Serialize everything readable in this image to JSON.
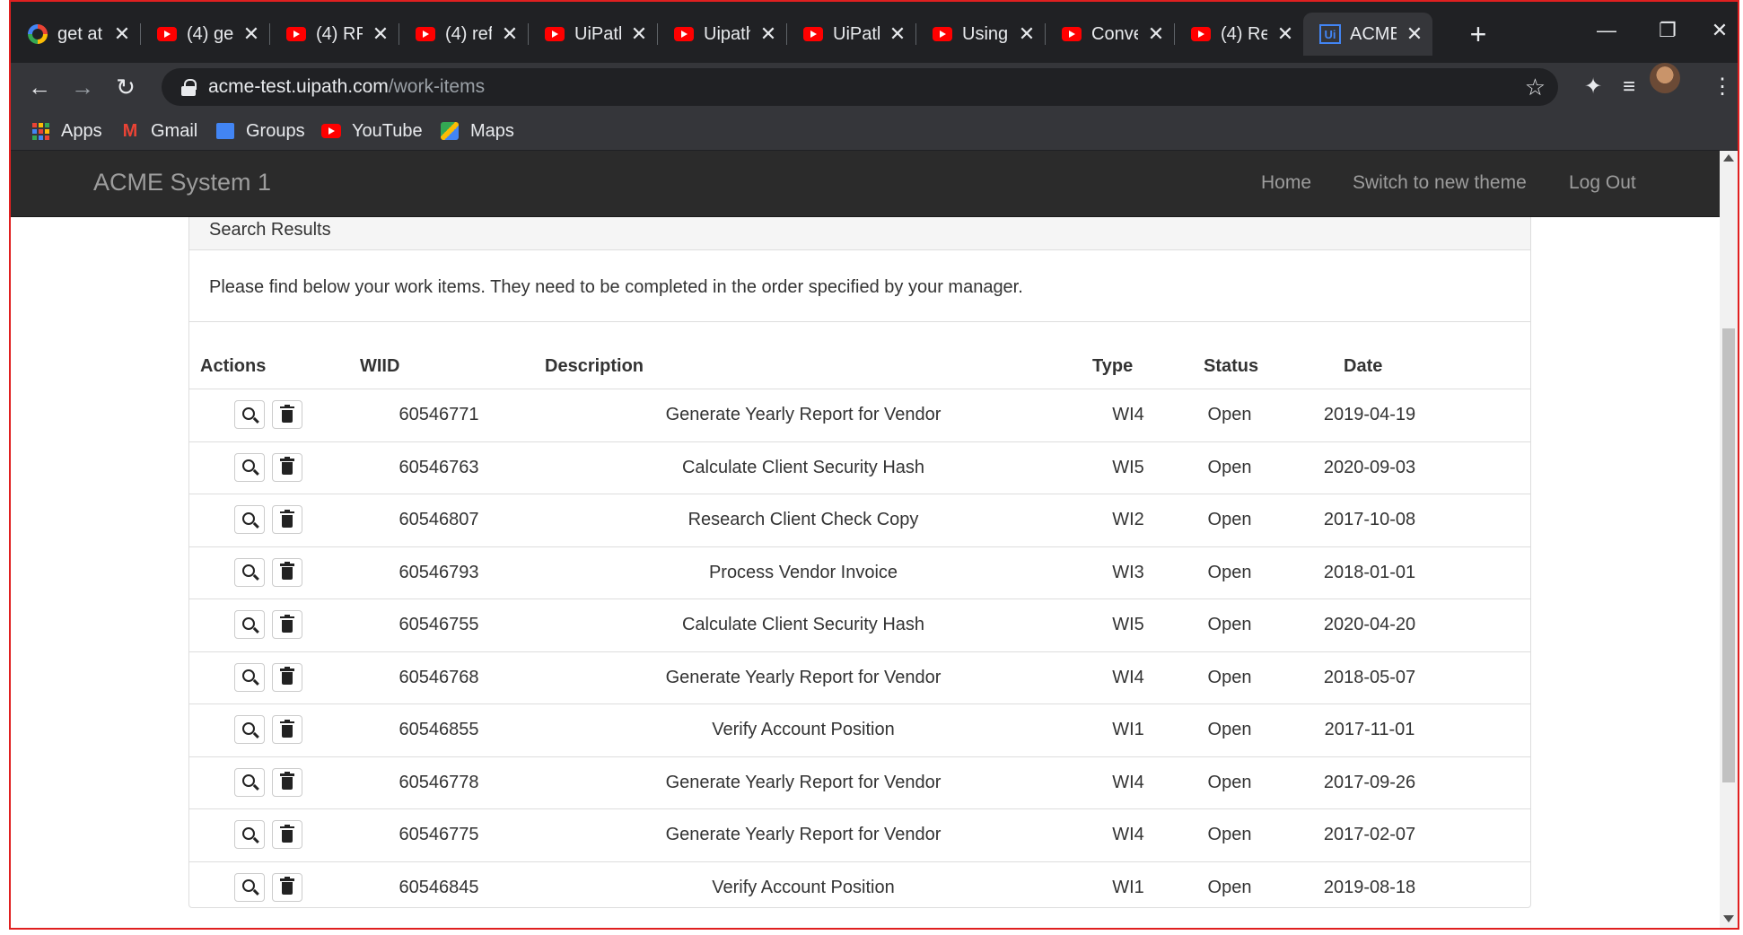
{
  "browser": {
    "tabs": [
      {
        "title": "get at",
        "icon": "google-icon"
      },
      {
        "title": "(4) ge",
        "icon": "youtube-icon"
      },
      {
        "title": "(4) RP",
        "icon": "youtube-icon"
      },
      {
        "title": "(4) ref",
        "icon": "youtube-icon"
      },
      {
        "title": "UiPath",
        "icon": "youtube-icon"
      },
      {
        "title": "Uipath",
        "icon": "youtube-icon"
      },
      {
        "title": "UiPath",
        "icon": "youtube-icon"
      },
      {
        "title": "Using",
        "icon": "youtube-icon"
      },
      {
        "title": "Conve",
        "icon": "youtube-icon"
      },
      {
        "title": "(4) Re",
        "icon": "youtube-icon"
      },
      {
        "title": "ACME",
        "icon": "uipath-icon",
        "active": true
      }
    ],
    "url_host": "acme-test.uipath.com",
    "url_path": "/work-items",
    "bookmarks": [
      {
        "label": "Apps",
        "icon": "apps-grid-icon"
      },
      {
        "label": "Gmail",
        "icon": "gmail-icon"
      },
      {
        "label": "Groups",
        "icon": "groups-icon"
      },
      {
        "label": "YouTube",
        "icon": "youtube-icon"
      },
      {
        "label": "Maps",
        "icon": "maps-icon"
      }
    ]
  },
  "app": {
    "brand": "ACME System 1",
    "nav": {
      "home": "Home",
      "theme": "Switch to new theme",
      "logout": "Log Out"
    }
  },
  "panel": {
    "title": "Search Results",
    "intro": "Please find below your work items. They need to be completed in the order specified by your manager."
  },
  "table": {
    "headers": {
      "actions": "Actions",
      "wiid": "WIID",
      "description": "Description",
      "type": "Type",
      "status": "Status",
      "date": "Date"
    },
    "rows": [
      {
        "wiid": "60546771",
        "description": "Generate Yearly Report for Vendor",
        "type": "WI4",
        "status": "Open",
        "date": "2019-04-19"
      },
      {
        "wiid": "60546763",
        "description": "Calculate Client Security Hash",
        "type": "WI5",
        "status": "Open",
        "date": "2020-09-03"
      },
      {
        "wiid": "60546807",
        "description": "Research Client Check Copy",
        "type": "WI2",
        "status": "Open",
        "date": "2017-10-08"
      },
      {
        "wiid": "60546793",
        "description": "Process Vendor Invoice",
        "type": "WI3",
        "status": "Open",
        "date": "2018-01-01"
      },
      {
        "wiid": "60546755",
        "description": "Calculate Client Security Hash",
        "type": "WI5",
        "status": "Open",
        "date": "2020-04-20"
      },
      {
        "wiid": "60546768",
        "description": "Generate Yearly Report for Vendor",
        "type": "WI4",
        "status": "Open",
        "date": "2018-05-07"
      },
      {
        "wiid": "60546855",
        "description": "Verify Account Position",
        "type": "WI1",
        "status": "Open",
        "date": "2017-11-01"
      },
      {
        "wiid": "60546778",
        "description": "Generate Yearly Report for Vendor",
        "type": "WI4",
        "status": "Open",
        "date": "2017-09-26"
      },
      {
        "wiid": "60546775",
        "description": "Generate Yearly Report for Vendor",
        "type": "WI4",
        "status": "Open",
        "date": "2017-02-07"
      },
      {
        "wiid": "60546845",
        "description": "Verify Account Position",
        "type": "WI1",
        "status": "Open",
        "date": "2019-08-18"
      }
    ]
  },
  "colors": {
    "frame": "#e02020",
    "navbar": "#2b2b2b",
    "nav_text": "#9d9d9d"
  }
}
